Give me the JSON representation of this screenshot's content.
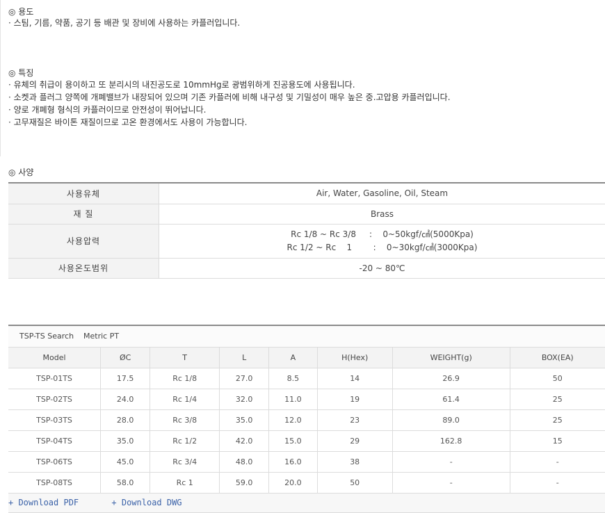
{
  "usage": {
    "heading": "◎ 용도",
    "items": [
      "· 스팀, 기름, 약품, 공기 등 배관 및 장비에 사용하는 카플러입니다."
    ]
  },
  "features": {
    "heading": "◎ 특징",
    "items": [
      "· 유체의 취급이 용이하고 또 분리시의 내진공도로 10mmHg로 광범위하게 진공용도에 사용됩니다.",
      "· 소켓과 플러그 양쪽에 개폐밸브가 내장되어 있으며 기존 카플러에 비해 내구성 및 기밀성이 매우 높은 중.고압용 카플러입니다.",
      "· 양로 개폐형 형식의 카플러이므로 안전성이 뛰어납니다.",
      "· 고무재질은 바이톤 재질이므로 고온 환경에서도 사용이 가능합니다."
    ]
  },
  "spec": {
    "heading": "◎ 사양",
    "rows": [
      {
        "key": "사용유체",
        "value": "Air, Water, Gasoline, Oil, Steam"
      },
      {
        "key": "재 질",
        "value": "Brass"
      },
      {
        "key": "사용압력",
        "value_lines": [
          "Rc 1/8 ~ Rc 3/8     :    0~50kgf/㎠(5000Kpa)",
          "Rc 1/2 ~ Rc    1        :    0~30kgf/㎠(3000Kpa)"
        ]
      },
      {
        "key": "사용온도범위",
        "value": "-20 ~ 80℃"
      }
    ]
  },
  "models": {
    "caption": "TSP-TS Search    Metric PT",
    "columns": [
      "Model",
      "ØC",
      "T",
      "L",
      "A",
      "H(Hex)",
      "WEIGHT(g)",
      "BOX(EA)"
    ],
    "rows": [
      [
        "TSP-01TS",
        "17.5",
        "Rc 1/8",
        "27.0",
        "8.5",
        "14",
        "26.9",
        "50"
      ],
      [
        "TSP-02TS",
        "24.0",
        "Rc 1/4",
        "32.0",
        "11.0",
        "19",
        "61.4",
        "25"
      ],
      [
        "TSP-03TS",
        "28.0",
        "Rc 3/8",
        "35.0",
        "12.0",
        "23",
        "89.0",
        "25"
      ],
      [
        "TSP-04TS",
        "35.0",
        "Rc 1/2",
        "42.0",
        "15.0",
        "29",
        "162.8",
        "15"
      ],
      [
        "TSP-06TS",
        "45.0",
        "Rc 3/4",
        "48.0",
        "16.0",
        "38",
        "-",
        "-"
      ],
      [
        "TSP-08TS",
        "58.0",
        "Rc 1",
        "59.0",
        "20.0",
        "50",
        "-",
        "-"
      ]
    ]
  },
  "downloads": {
    "pdf": "+ Download PDF",
    "dwg": "+ Download DWG"
  }
}
